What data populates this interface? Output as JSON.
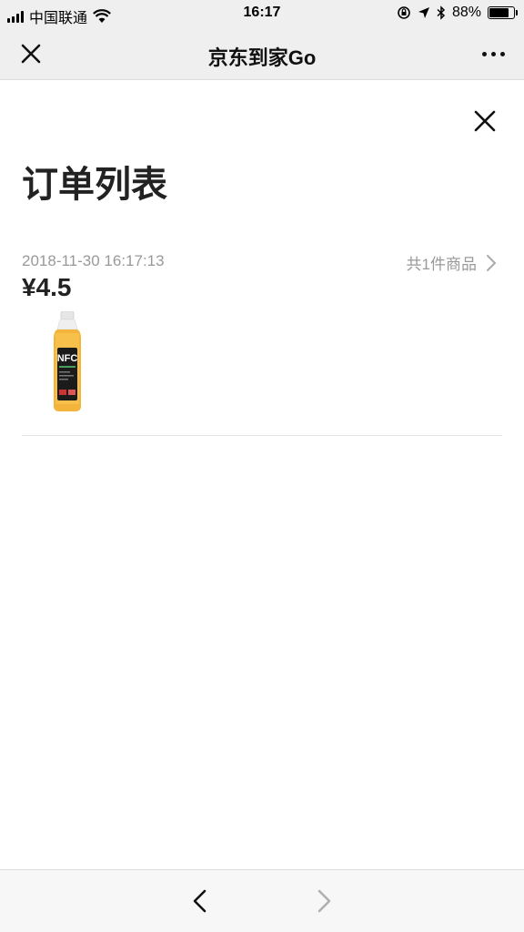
{
  "status_bar": {
    "carrier": "中国联通",
    "time": "16:17",
    "battery": "88%",
    "battery_level": 0.88
  },
  "nav_bar": {
    "title": "京东到家Go"
  },
  "page": {
    "title": "订单列表"
  },
  "orders": [
    {
      "datetime": "2018-11-30 16:17:13",
      "price": "¥4.5",
      "item_count": "共1件商品",
      "product_label": "NFC"
    }
  ]
}
